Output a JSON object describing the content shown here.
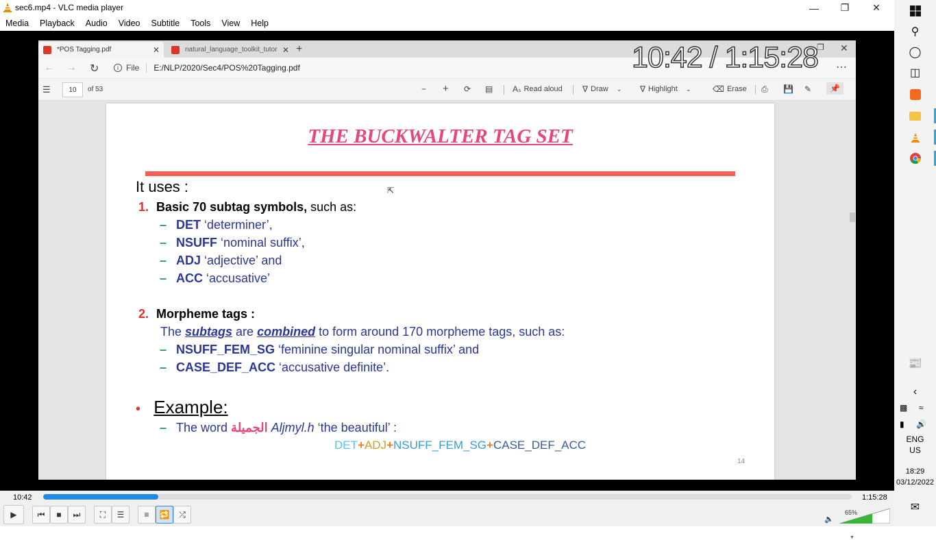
{
  "window": {
    "title": "sec6.mp4 - VLC media player"
  },
  "menu": [
    "Media",
    "Playback",
    "Audio",
    "Video",
    "Subtitle",
    "Tools",
    "View",
    "Help"
  ],
  "browser": {
    "tabs": [
      {
        "label": "*POS Tagging.pdf"
      },
      {
        "label": "natural_language_toolkit_tutorial"
      }
    ],
    "url_prefix": "File",
    "url": "E:/NLP/2020/Sec4/POS%20Tagging.pdf",
    "page_current": "10",
    "page_total": "of 53",
    "toolbar": {
      "read_aloud": "Read aloud",
      "draw": "Draw",
      "highlight": "Highlight",
      "erase": "Erase"
    }
  },
  "slide": {
    "title": "THE BUCKWALTER TAG SET",
    "intro": "It uses :",
    "item1_num": "1.",
    "item1_bold": "Basic 70 subtag symbols,",
    "item1_rest": " such as:",
    "sub1": [
      {
        "tag": "DET",
        "desc": " ‘determiner’,"
      },
      {
        "tag": "NSUFF",
        "desc": " ‘nominal suffix’,"
      },
      {
        "tag": "ADJ",
        "desc": " ‘adjective’ and"
      },
      {
        "tag": "ACC",
        "desc": " ‘accusative’"
      }
    ],
    "item2_num": "2.",
    "item2_bold": "Morpheme tags :",
    "item2_line_a": "The ",
    "item2_subtags": "subtags",
    "item2_line_b": " are ",
    "item2_combined": "combined",
    "item2_line_c": " to form around 170 morpheme tags, such as:",
    "sub2": [
      {
        "tag": "NSUFF_FEM_SG",
        "desc": " ‘feminine singular nominal suffix’ and"
      },
      {
        "tag": "CASE_DEF_ACC",
        "desc": " ‘accusative definite’."
      }
    ],
    "example_bullet": "•",
    "example_label": "Example:",
    "example_pre": "The word ",
    "example_arabic": "الجميلة",
    "example_translit": "Aljmyl.h",
    "example_post": " ‘the beautiful’ :",
    "tag_seq": [
      {
        "text": "DET",
        "color": "#5bc0eb"
      },
      {
        "text": "+",
        "color": "#e0802a"
      },
      {
        "text": "ADJ",
        "color": "#c8a51a"
      },
      {
        "text": "+",
        "color": "#e0802a"
      },
      {
        "text": "NSUFF_FEM_SG",
        "color": "#3a9bd6"
      },
      {
        "text": "+",
        "color": "#e0802a"
      },
      {
        "text": "CASE_DEF_ACC",
        "color": "#3b5b9a"
      }
    ],
    "page_number": "14"
  },
  "overlay_time": "10:42 / 1:15:28",
  "player": {
    "current_time": "10:42",
    "total_time": "1:15:28",
    "progress_fraction": 0.142,
    "volume": "65%"
  },
  "taskbar": {
    "lang_1": "ENG",
    "lang_2": "US",
    "time": "18:29",
    "date": "03/12/2022"
  }
}
